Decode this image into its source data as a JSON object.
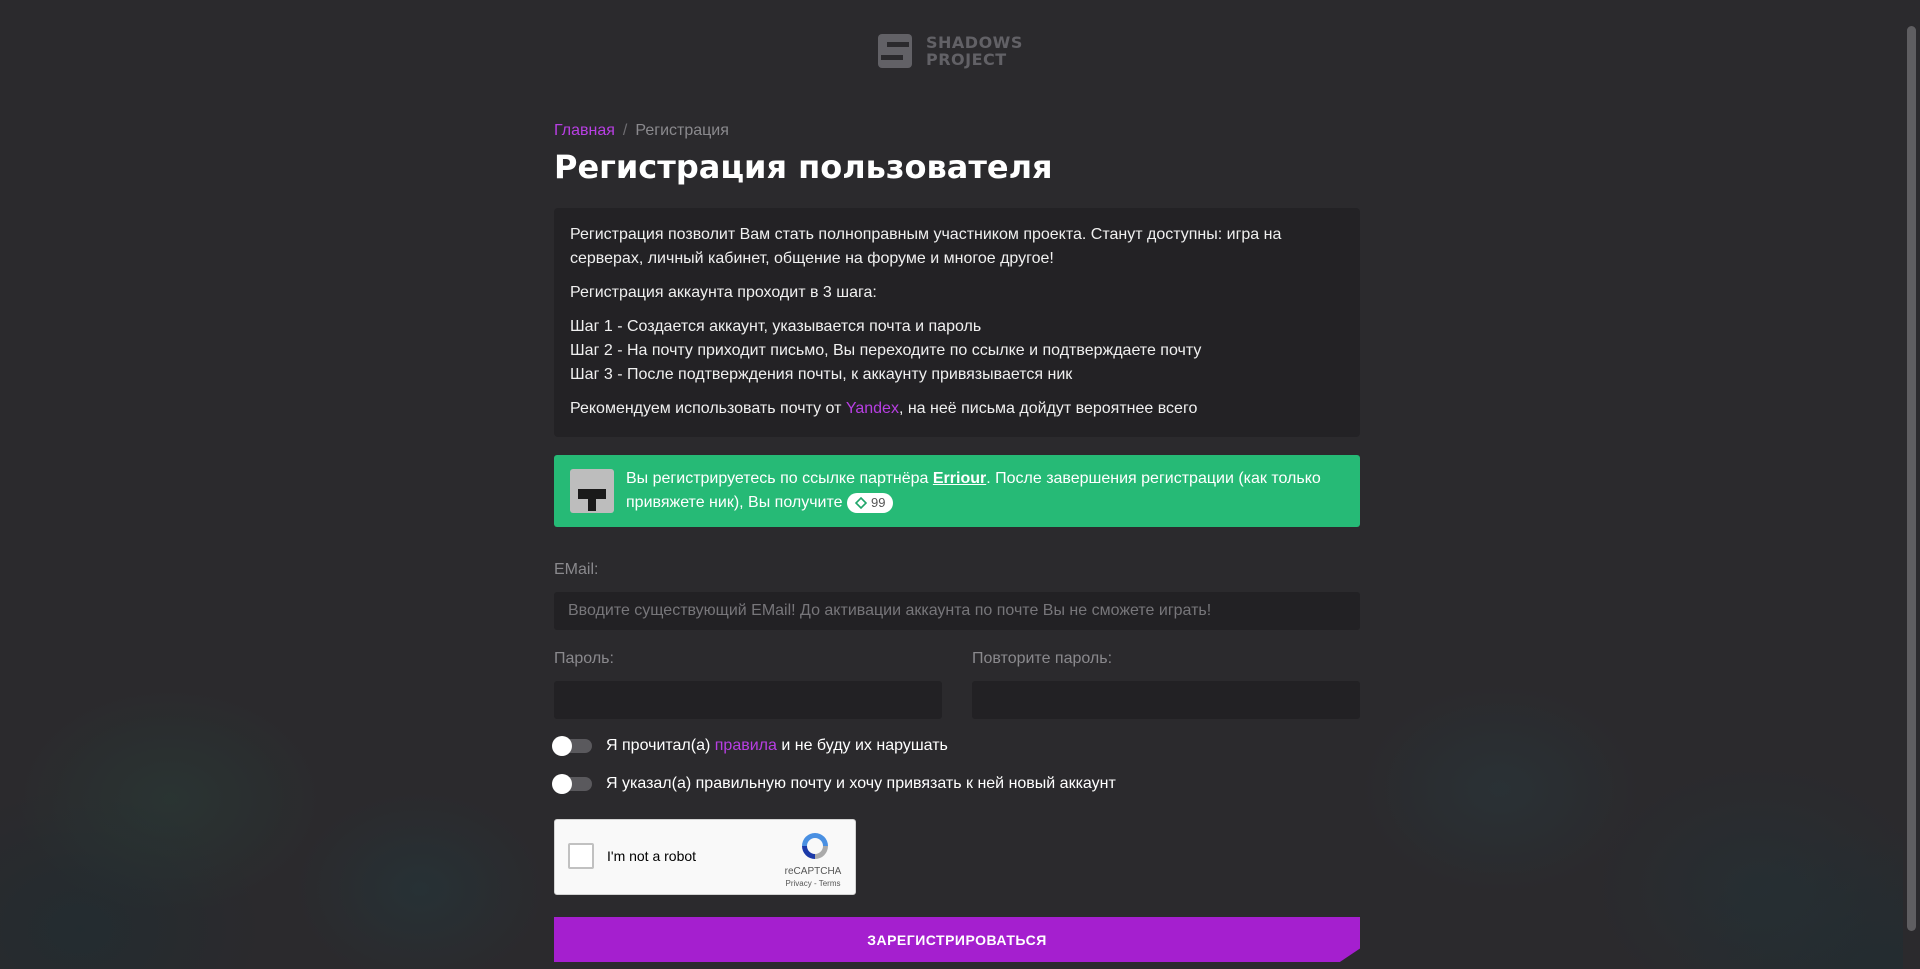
{
  "logo": {
    "line1": "SHADOWS",
    "line2": "PROJECT"
  },
  "breadcrumb": {
    "home": "Главная",
    "separator": "/",
    "current": "Регистрация"
  },
  "page_title": "Регистрация пользователя",
  "info": {
    "intro": "Регистрация позволит Вам стать полноправным участником проекта. Станут доступны: игра на серверах, личный кабинет, общение на форуме и многое другое!",
    "steps_heading": "Регистрация аккаунта проходит в 3 шага:",
    "step1": "Шаг 1 - Создается аккаунт, указывается почта и пароль",
    "step2": "Шаг 2 - На почту приходит письмо, Вы переходите по ссылке и подтверждаете почту",
    "step3": "Шаг 3 - После подтверждения почты, к аккаунту привязывается ник",
    "recommend_before": "Рекомендуем использовать почту от ",
    "recommend_link": "Yandex",
    "recommend_after": ", на неё письма дойдут вероятнее всего"
  },
  "partner": {
    "text_before": "Вы регистрируетесь по ссылке партнёра ",
    "partner_name": "Erriour",
    "text_after": ". После завершения регистрации (как только привяжете ник), Вы получите ",
    "bonus_icon": "diamond-icon",
    "bonus_value": "99"
  },
  "form": {
    "email_label": "EMail:",
    "email_placeholder": "Вводите существующий EMail! До активации аккаунта по почте Вы не сможете играть!",
    "password_label": "Пароль:",
    "password_repeat_label": "Повторите пароль:",
    "rules_before": "Я прочитал(а) ",
    "rules_link": "правила",
    "rules_after": " и не буду их нарушать",
    "email_confirm": "Я указал(а) правильную почту и хочу привязать к ней новый аккаунт",
    "submit_label": "ЗАРЕГИСТРИРОВАТЬСЯ"
  },
  "captcha": {
    "label": "I'm not a robot",
    "brand": "reCAPTCHA",
    "terms": "Privacy - Terms"
  },
  "colors": {
    "background": "#2b2a2d",
    "accent": "#b83fe3",
    "button": "#a51fcf",
    "partner_bg": "#26ba76"
  }
}
